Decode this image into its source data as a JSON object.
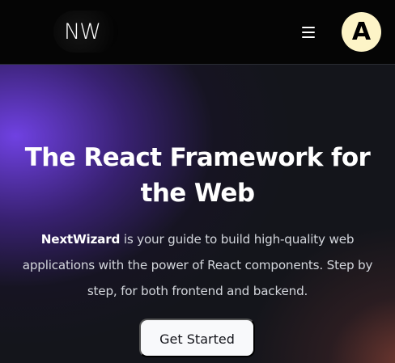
{
  "header": {
    "logo_text": "NW",
    "menu_icon": "hamburger-menu-icon",
    "avatar_initial": "A"
  },
  "hero": {
    "title": "The React Framework for the Web",
    "description_brand": "NextWizard",
    "description_rest": " is your guide to build high-quality web applications with the power of React components. Step by step, for both frontend and backend.",
    "cta_label": "Get Started"
  },
  "colors": {
    "nav_background": "#050505",
    "hero_background": "#14151b",
    "purple_glow": "#7142e6",
    "warm_glow": "#7a3c32",
    "avatar_background": "#fdf4c7",
    "cta_background": "#f8f9fb",
    "text_primary": "#ffffff",
    "text_secondary": "#d3d6dc"
  }
}
